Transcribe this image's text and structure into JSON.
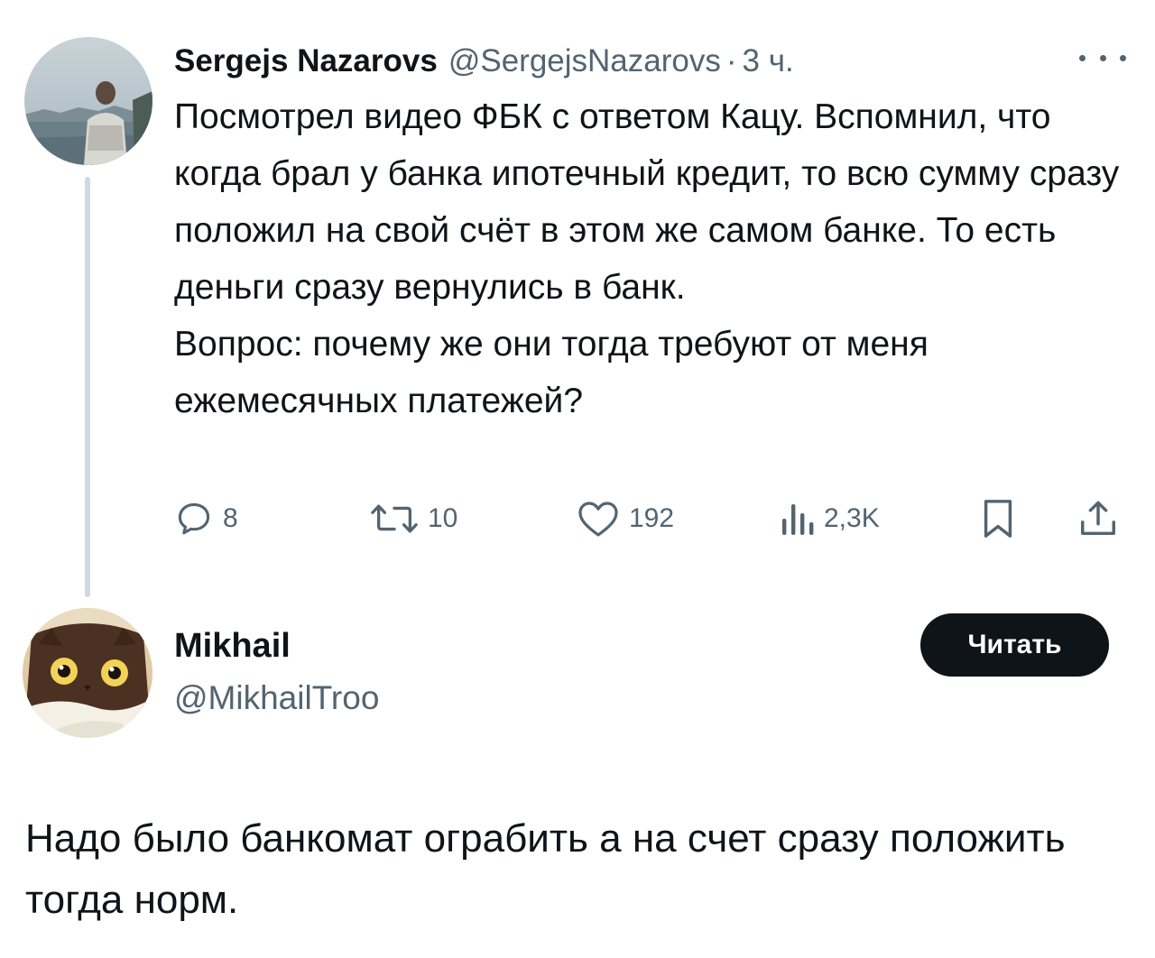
{
  "tweet1": {
    "name": "Sergejs Nazarovs",
    "handle": "@SergejsNazarovs",
    "separator": "·",
    "time": "3 ч.",
    "paragraphs": [
      "Посмотрел видео ФБК с ответом Кацу. Вспомнил, что когда брал у банка ипотечный кредит, то всю сумму сразу положил на свой счёт в этом же самом банке. То есть деньги сразу вернулись в банк.",
      "Вопрос: почему же они тогда требуют от меня ежемесячных платежей?"
    ],
    "stats": {
      "replies": "8",
      "retweets": "10",
      "likes": "192",
      "views": "2,3K"
    },
    "icons": [
      "more-icon",
      "reply-icon",
      "retweet-icon",
      "like-icon",
      "views-icon",
      "bookmark-icon",
      "share-icon"
    ]
  },
  "tweet2": {
    "name": "Mikhail",
    "handle": "@MikhailTroo",
    "follow_label": "Читать",
    "text": "Надо было банкомат ограбить а на счет сразу положить тогда норм."
  },
  "colors": {
    "text": "#0f1419",
    "secondary": "#536471",
    "thread_line": "#cfd9de",
    "button_bg": "#0f1419"
  }
}
